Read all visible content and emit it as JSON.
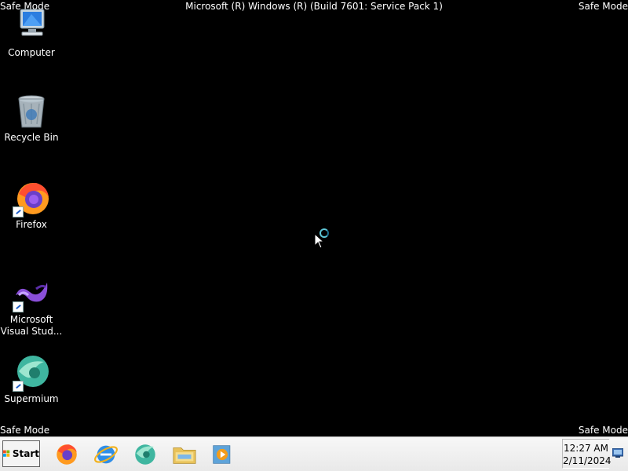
{
  "watermark": {
    "top_left": "Safe Mode",
    "top_right": "Safe Mode",
    "bottom_left": "Safe Mode",
    "bottom_right": "Safe Mode",
    "build": "Microsoft (R) Windows (R) (Build 7601: Service Pack 1)"
  },
  "desktop": {
    "icons": [
      {
        "label": "Computer",
        "icon": "computer-icon"
      },
      {
        "label": "Recycle Bin",
        "icon": "recycle-bin-icon"
      },
      {
        "label": "Firefox",
        "icon": "firefox-icon"
      },
      {
        "label_line1": "Microsoft",
        "label_line2": "Visual Stud...",
        "icon": "visual-studio-icon"
      },
      {
        "label": "Supermium",
        "icon": "supermium-icon"
      }
    ]
  },
  "taskbar": {
    "start_label": "Start",
    "pinned": [
      "firefox-icon",
      "internet-explorer-icon",
      "supermium-icon",
      "file-explorer-icon",
      "media-player-icon"
    ],
    "clock": {
      "time": "12:27 AM",
      "date": "2/11/2024"
    }
  },
  "colors": {
    "taskbar_bg": "#f0f0f0",
    "desktop_bg": "#000000",
    "busy_accent": "#5ec6d6"
  }
}
